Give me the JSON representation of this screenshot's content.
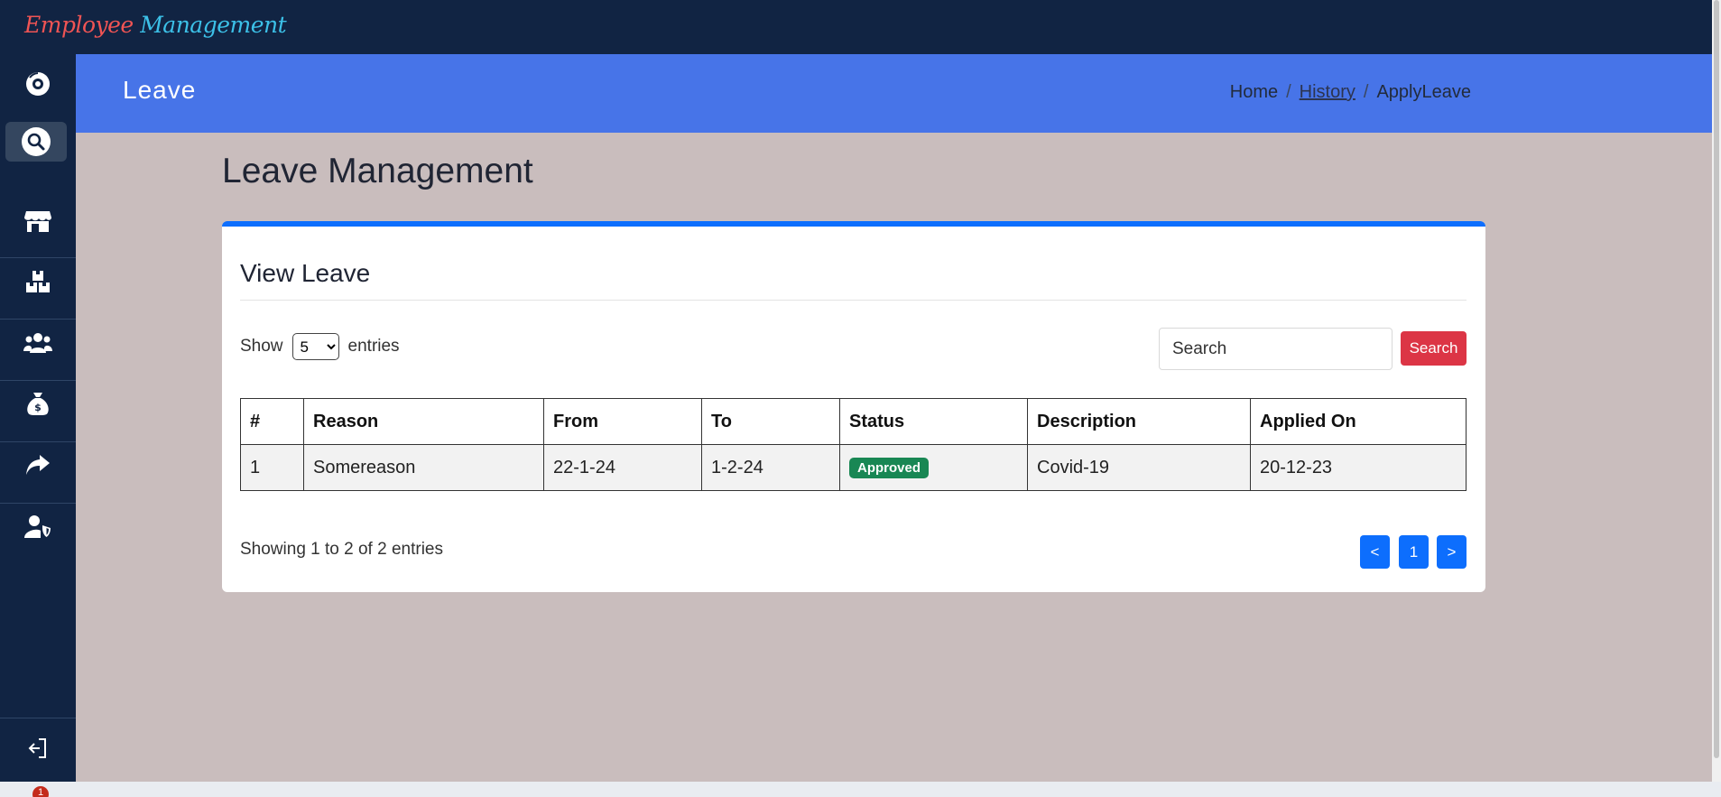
{
  "app": {
    "logo_word1": "Employee",
    "logo_word2": "Management"
  },
  "header": {
    "title": "Leave"
  },
  "breadcrumb": {
    "home": "Home",
    "history": "History",
    "current": "ApplyLeave",
    "separator": "/"
  },
  "page": {
    "title": "Leave Management"
  },
  "card": {
    "title": "View Leave"
  },
  "entries": {
    "show_label": "Show",
    "suffix_label": "entries",
    "selected": "5",
    "options": [
      "5"
    ]
  },
  "search": {
    "placeholder": "Search",
    "button_label": "Search"
  },
  "table": {
    "columns": [
      "#",
      "Reason",
      "From",
      "To",
      "Status",
      "Description",
      "Applied On"
    ],
    "rows": [
      {
        "num": "1",
        "reason": "Somereason",
        "from": "22-1-24",
        "to": "1-2-24",
        "status": "Approved",
        "description": "Covid-19",
        "applied_on": "20-12-23"
      }
    ]
  },
  "footer": {
    "showing": "Showing 1 to 2 of 2 entries"
  },
  "pagination": {
    "prev": "<",
    "page": "1",
    "next": ">"
  },
  "sidebar": {
    "icons": [
      "dashboard-icon",
      "search-icon",
      "store-icon",
      "boxes-icon",
      "users-icon",
      "money-bag-icon",
      "share-icon",
      "user-shield-icon",
      "logout-icon"
    ]
  },
  "taskbar": {
    "notification_count": "1"
  },
  "colors": {
    "navy": "#112443",
    "header_blue": "#4774e8",
    "primary": "#0d6efd",
    "danger": "#dc3545",
    "success": "#198754",
    "page_bg": "#c9bdbd"
  }
}
